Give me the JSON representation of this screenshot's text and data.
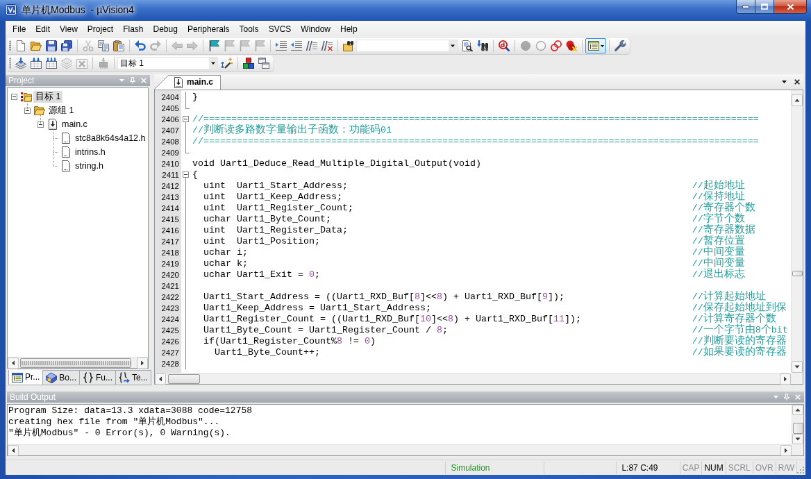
{
  "window": {
    "title": "单片机Modbus  - µVision4"
  },
  "menu": [
    {
      "label": "File"
    },
    {
      "label": "Edit"
    },
    {
      "label": "View"
    },
    {
      "label": "Project"
    },
    {
      "label": "Flash"
    },
    {
      "label": "Debug"
    },
    {
      "label": "Peripherals"
    },
    {
      "label": "Tools"
    },
    {
      "label": "SVCS"
    },
    {
      "label": "Window"
    },
    {
      "label": "Help"
    }
  ],
  "toolbars": [
    {
      "items": [
        {
          "kind": "button",
          "disabled": false,
          "on": false
        },
        {
          "kind": "button",
          "disabled": false,
          "on": false
        },
        {
          "kind": "button",
          "disabled": false,
          "on": false
        },
        {
          "kind": "button",
          "disabled": false,
          "on": false
        },
        {
          "kind": "separator"
        },
        {
          "kind": "button",
          "disabled": true,
          "on": false
        },
        {
          "kind": "button",
          "disabled": false,
          "on": false
        },
        {
          "kind": "button",
          "disabled": false,
          "on": false
        },
        {
          "kind": "separator"
        },
        {
          "kind": "button",
          "disabled": false,
          "on": false
        },
        {
          "kind": "button",
          "disabled": true,
          "on": false
        },
        {
          "kind": "separator"
        },
        {
          "kind": "button",
          "disabled": true,
          "on": false
        },
        {
          "kind": "button",
          "disabled": true,
          "on": false
        },
        {
          "kind": "separator"
        },
        {
          "kind": "button",
          "disabled": false,
          "on": false
        },
        {
          "kind": "button",
          "disabled": true,
          "on": false
        },
        {
          "kind": "button",
          "disabled": true,
          "on": false
        },
        {
          "kind": "button",
          "disabled": true,
          "on": false
        },
        {
          "kind": "separator"
        },
        {
          "kind": "button",
          "disabled": false,
          "on": false
        },
        {
          "kind": "button",
          "disabled": false,
          "on": false
        },
        {
          "kind": "button",
          "disabled": false,
          "on": false
        },
        {
          "kind": "button",
          "disabled": false,
          "on": false
        },
        {
          "kind": "separator"
        },
        {
          "kind": "button",
          "disabled": false,
          "on": false
        },
        {
          "kind": "combo"
        },
        {
          "kind": "button",
          "disabled": false,
          "on": false
        },
        {
          "kind": "button",
          "disabled": false,
          "on": false
        },
        {
          "kind": "separator"
        },
        {
          "kind": "button",
          "disabled": false,
          "on": false
        },
        {
          "kind": "separator"
        },
        {
          "kind": "button",
          "disabled": true,
          "on": false
        },
        {
          "kind": "button",
          "disabled": true,
          "on": false
        },
        {
          "kind": "button",
          "disabled": false,
          "on": false
        },
        {
          "kind": "button",
          "disabled": false,
          "on": false
        },
        {
          "kind": "separator"
        },
        {
          "kind": "split",
          "disabled": false,
          "on": true
        },
        {
          "kind": "separator"
        },
        {
          "kind": "button",
          "disabled": false,
          "on": false
        }
      ]
    },
    {
      "items": [
        {
          "kind": "button",
          "disabled": false,
          "on": false
        },
        {
          "kind": "button",
          "disabled": false,
          "on": false
        },
        {
          "kind": "button",
          "disabled": false,
          "on": false
        },
        {
          "kind": "button",
          "disabled": true,
          "on": false
        },
        {
          "kind": "button",
          "disabled": true,
          "on": false
        },
        {
          "kind": "separator"
        },
        {
          "kind": "button",
          "disabled": true,
          "on": false
        },
        {
          "kind": "separator"
        },
        {
          "kind": "combo",
          "value": "目标 1"
        },
        {
          "kind": "button",
          "disabled": false,
          "on": false
        },
        {
          "kind": "separator"
        },
        {
          "kind": "button",
          "disabled": false,
          "on": false
        },
        {
          "kind": "button",
          "disabled": false,
          "on": false
        }
      ]
    }
  ],
  "project": {
    "title": "Project",
    "tree": [
      {
        "label": "目标 1",
        "selected": true,
        "expanded": true,
        "children": [
          {
            "label": "源组 1",
            "selected": false,
            "expanded": true,
            "children": [
              {
                "label": "main.c",
                "selected": false,
                "expanded": true,
                "children": [
                  {
                    "label": "stc8a8k64s4a12.h",
                    "selected": false
                  },
                  {
                    "label": "intrins.h",
                    "selected": false
                  },
                  {
                    "label": "string.h",
                    "selected": false
                  }
                ]
              }
            ]
          }
        ]
      }
    ],
    "tabs": [
      {
        "label": "Pr...",
        "selected": true
      },
      {
        "label": "Bo...",
        "selected": false
      },
      {
        "label": "Fu...",
        "selected": false
      },
      {
        "label": "Te...",
        "selected": false
      }
    ]
  },
  "editor": {
    "tabs": [
      {
        "label": "main.c",
        "selected": true
      }
    ],
    "lines": [
      {
        "number": "2404",
        "code": "}",
        "kind": "body"
      },
      {
        "number": "2405",
        "kind": "end"
      },
      {
        "number": "2406",
        "comment": "//====================================================================================================",
        "kind": "start"
      },
      {
        "number": "2407",
        "comment": "//判断读多路数字量输出子函数：功能码01",
        "kind": "body"
      },
      {
        "number": "2408",
        "comment": "//====================================================================================================",
        "kind": "body"
      },
      {
        "number": "2409",
        "kind": "end"
      },
      {
        "number": "2410",
        "code": "void Uart1_Deduce_Read_Multiple_Digital_Output(void)",
        "kind": "plain"
      },
      {
        "number": "2411",
        "code": "{",
        "kind": "start"
      },
      {
        "number": "2412",
        "code": "  uint  Uart1_Start_Address;",
        "comment": "//起始地址",
        "kind": "body"
      },
      {
        "number": "2413",
        "code": "  uint  Uart1_Keep_Address;",
        "comment": "//保持地址",
        "kind": "body"
      },
      {
        "number": "2414",
        "code": "  uint  Uart1_Register_Count;",
        "comment": "//寄存器个数",
        "kind": "body"
      },
      {
        "number": "2415",
        "code": "  uchar Uart1_Byte_Count;",
        "comment": "//字节个数",
        "kind": "body"
      },
      {
        "number": "2416",
        "code": "  uint  Uart1_Register_Data;",
        "comment": "//寄存器数据",
        "kind": "body"
      },
      {
        "number": "2417",
        "code": "  uint  Uart1_Position;",
        "comment": "//暂存位置",
        "kind": "body"
      },
      {
        "number": "2418",
        "code": "  uchar i;",
        "comment": "//中间变量",
        "kind": "body"
      },
      {
        "number": "2419",
        "code": "  uchar k;",
        "comment": "//中间变量",
        "kind": "body"
      },
      {
        "number": "2420",
        "code": "  uchar Uart1_Exit = 0;",
        "comment": "//退出标志",
        "kind": "body"
      },
      {
        "number": "2421",
        "kind": "body"
      },
      {
        "number": "2422",
        "code": "  Uart1_Start_Address = ((Uart1_RXD_Buf[8]<<8) + Uart1_RXD_Buf[9]);",
        "comment": "//计算起始地址",
        "kind": "body"
      },
      {
        "number": "2423",
        "code": "  Uart1_Keep_Address = Uart1_Start_Address;",
        "comment": "//保存起始地址到保",
        "kind": "body"
      },
      {
        "number": "2424",
        "code": "  Uart1_Register_Count = ((Uart1_RXD_Buf[10]<<8) + Uart1_RXD_Buf[11]);",
        "comment": "//计算寄存器个数",
        "kind": "body"
      },
      {
        "number": "2425",
        "code": "  Uart1_Byte_Count = Uart1_Register_Count / 8;",
        "comment": "//一个字节由8个bit",
        "kind": "body"
      },
      {
        "number": "2426",
        "code": "  if(Uart1_Register_Count%8 != 0)",
        "comment": "//判断要读的寄存器",
        "kind": "body"
      },
      {
        "number": "2427",
        "code": "    Uart1_Byte_Count++;",
        "comment": "//如果要读的寄存器",
        "kind": "body"
      },
      {
        "number": "2428",
        "kind": "body"
      }
    ]
  },
  "build_output": {
    "title": "Build Output",
    "lines": [
      "Program Size: data=13.3 xdata=3088 code=12758",
      "creating hex file from \"单片机Modbus\"...",
      "\"单片机Modbus\" - 0 Error(s), 0 Warning(s)."
    ]
  },
  "status_bar": {
    "mode": "Simulation",
    "cursor": "L:87 C:49",
    "indicators": [
      {
        "label": "CAP",
        "on": false
      },
      {
        "label": "NUM",
        "on": true
      },
      {
        "label": "SCRL",
        "on": false
      },
      {
        "label": "OVR",
        "on": false
      },
      {
        "label": "R/W",
        "on": false
      }
    ]
  }
}
